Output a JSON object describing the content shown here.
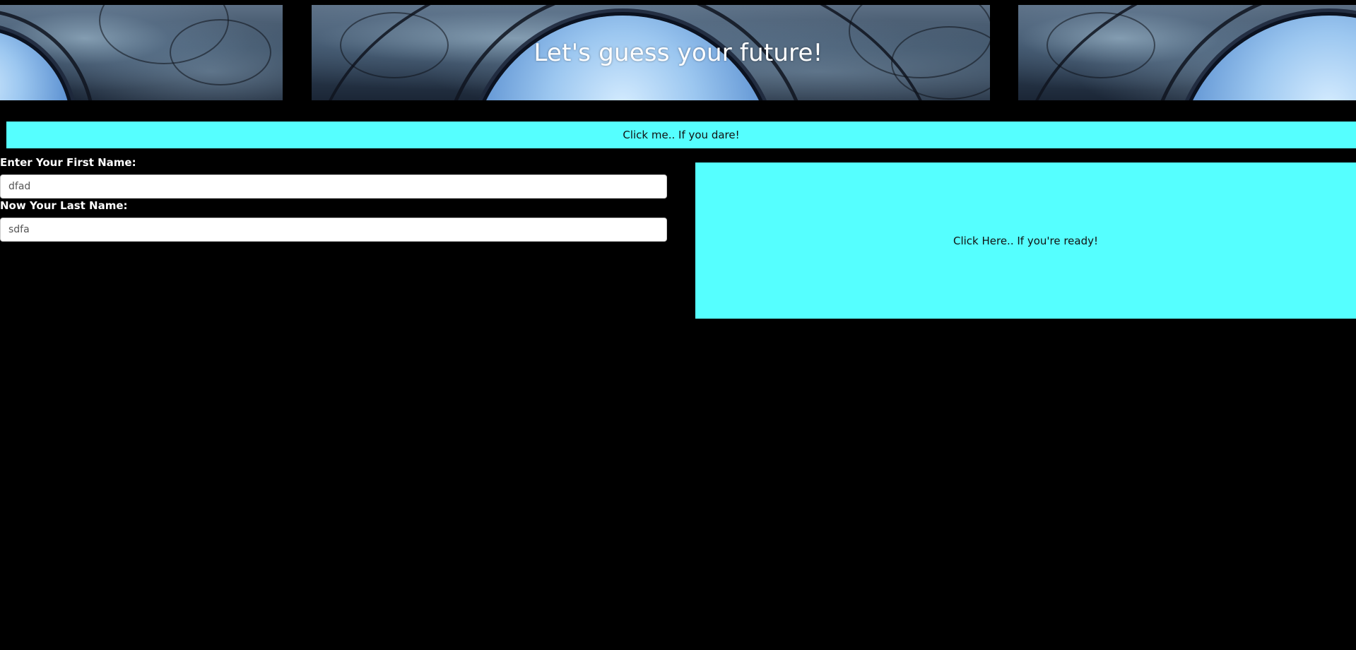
{
  "header": {
    "title": "Let's guess your future!",
    "banner_image": "crystal-orb-fractal-banner"
  },
  "dare_button": {
    "label": "Click me.. If you dare!"
  },
  "form": {
    "first_name": {
      "label": "Enter Your First Name:",
      "value": "dfad"
    },
    "last_name": {
      "label": "Now Your Last Name:",
      "value": "sdfa"
    }
  },
  "ready_button": {
    "label": "Click Here.. If you're ready!"
  },
  "colors": {
    "page_background": "#000000",
    "button_background": "#55ffff",
    "label_text": "#ffffff"
  }
}
